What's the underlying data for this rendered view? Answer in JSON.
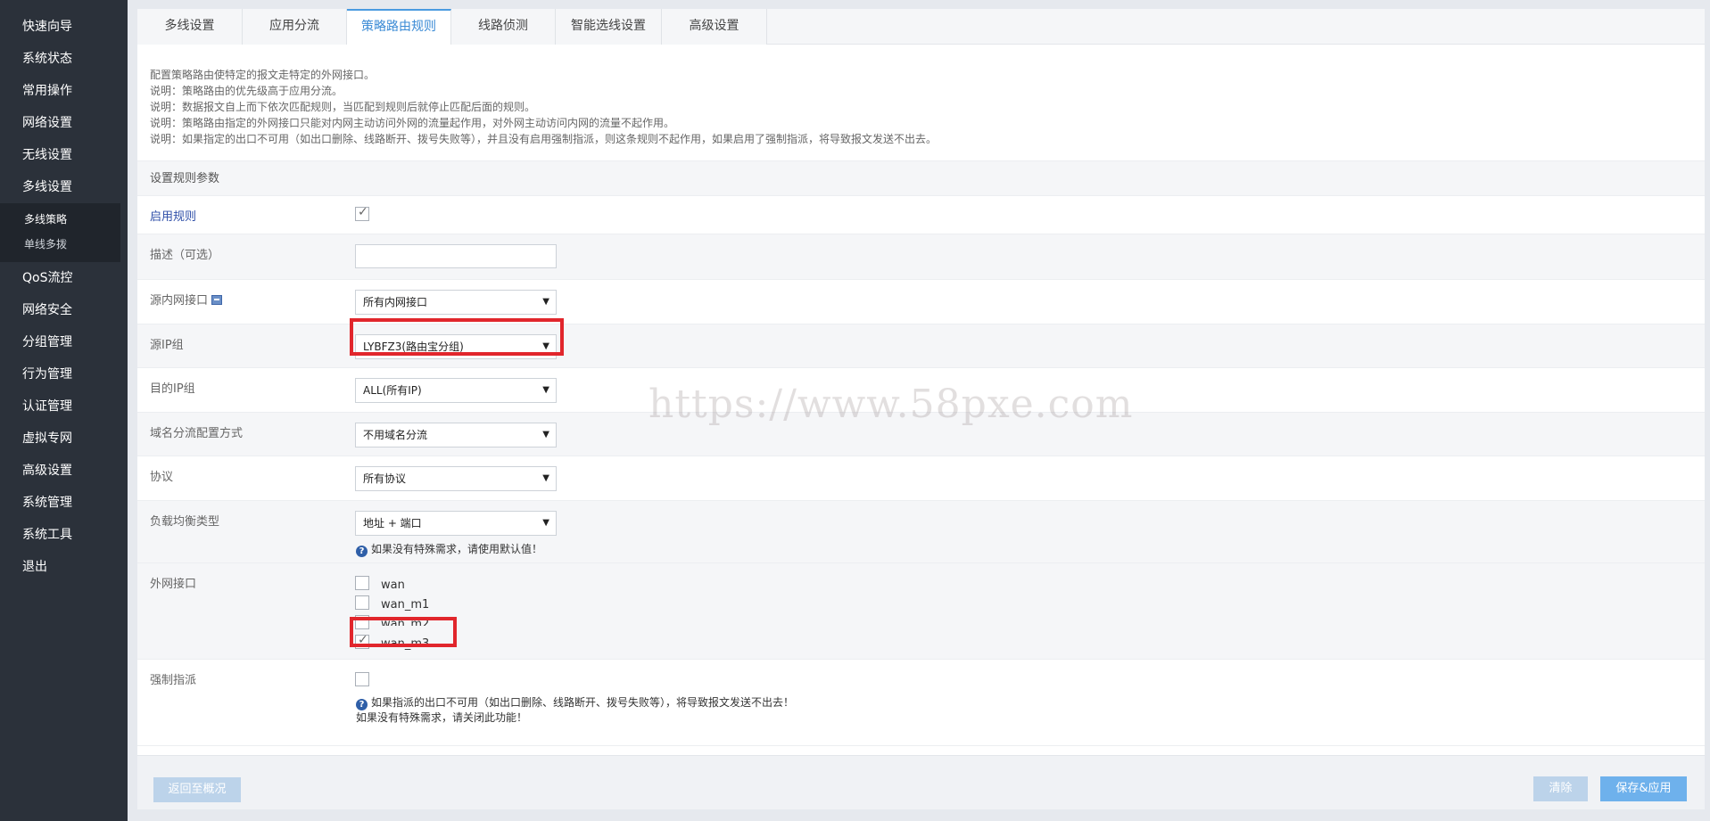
{
  "sidebar": {
    "items_top": [
      "快速向导",
      "系统状态",
      "常用操作",
      "网络设置",
      "无线设置",
      "多线设置"
    ],
    "submenu": [
      "多线策略",
      "单线多拨"
    ],
    "items_bottom": [
      "QoS流控",
      "网络安全",
      "分组管理",
      "行为管理",
      "认证管理",
      "虚拟专网",
      "高级设置",
      "系统管理",
      "系统工具",
      "退出"
    ]
  },
  "tabs": [
    "多线设置",
    "应用分流",
    "策略路由规则",
    "线路侦测",
    "智能选线设置",
    "高级设置"
  ],
  "description": [
    "配置策略路由使特定的报文走特定的外网接口。",
    "说明：策略路由的优先级高于应用分流。",
    "说明：数据报文自上而下依次匹配规则，当匹配到规则后就停止匹配后面的规则。",
    "说明：策略路由指定的外网接口只能对内网主动访问外网的流量起作用，对外网主动访问内网的流量不起作用。",
    "说明：如果指定的出口不可用（如出口删除、线路断开、拨号失败等），并且没有启用强制指派，则这条规则不起作用，如果启用了强制指派，将导致报文发送不出去。"
  ],
  "section_title": "设置规则参数",
  "form": {
    "enable_label": "启用规则",
    "desc_label": "描述（可选）",
    "src_iface_label": "源内网接口",
    "src_iface_value": "所有内网接口",
    "src_ip_label": "源IP组",
    "src_ip_value": "LYBFZ3(路由宝分组)",
    "dst_ip_label": "目的IP组",
    "dst_ip_value": "ALL(所有IP)",
    "domain_label": "域名分流配置方式",
    "domain_value": "不用域名分流",
    "proto_label": "协议",
    "proto_value": "所有协议",
    "lb_label": "负载均衡类型",
    "lb_value": "地址 + 端口",
    "lb_hint": "如果没有特殊需求，请使用默认值！",
    "wan_label": "外网接口",
    "wan_options": [
      "wan",
      "wan_m1",
      "wan_m2",
      "wan_m3"
    ],
    "force_label": "强制指派",
    "force_hint1": "如果指派的出口不可用（如出口删除、线路断开、拨号失败等），将导致报文发送不出去！",
    "force_hint2": "如果没有特殊需求，请关闭此功能！"
  },
  "buttons": {
    "back": "返回至概况",
    "clear": "清除",
    "save": "保存&应用"
  },
  "watermark": "https://www.58pxe.com",
  "colors": {
    "sidebar_bg": "#2b313a",
    "accent": "#3a8ad5",
    "highlight_red": "#e1262c",
    "save_button": "#6eb1ec"
  }
}
